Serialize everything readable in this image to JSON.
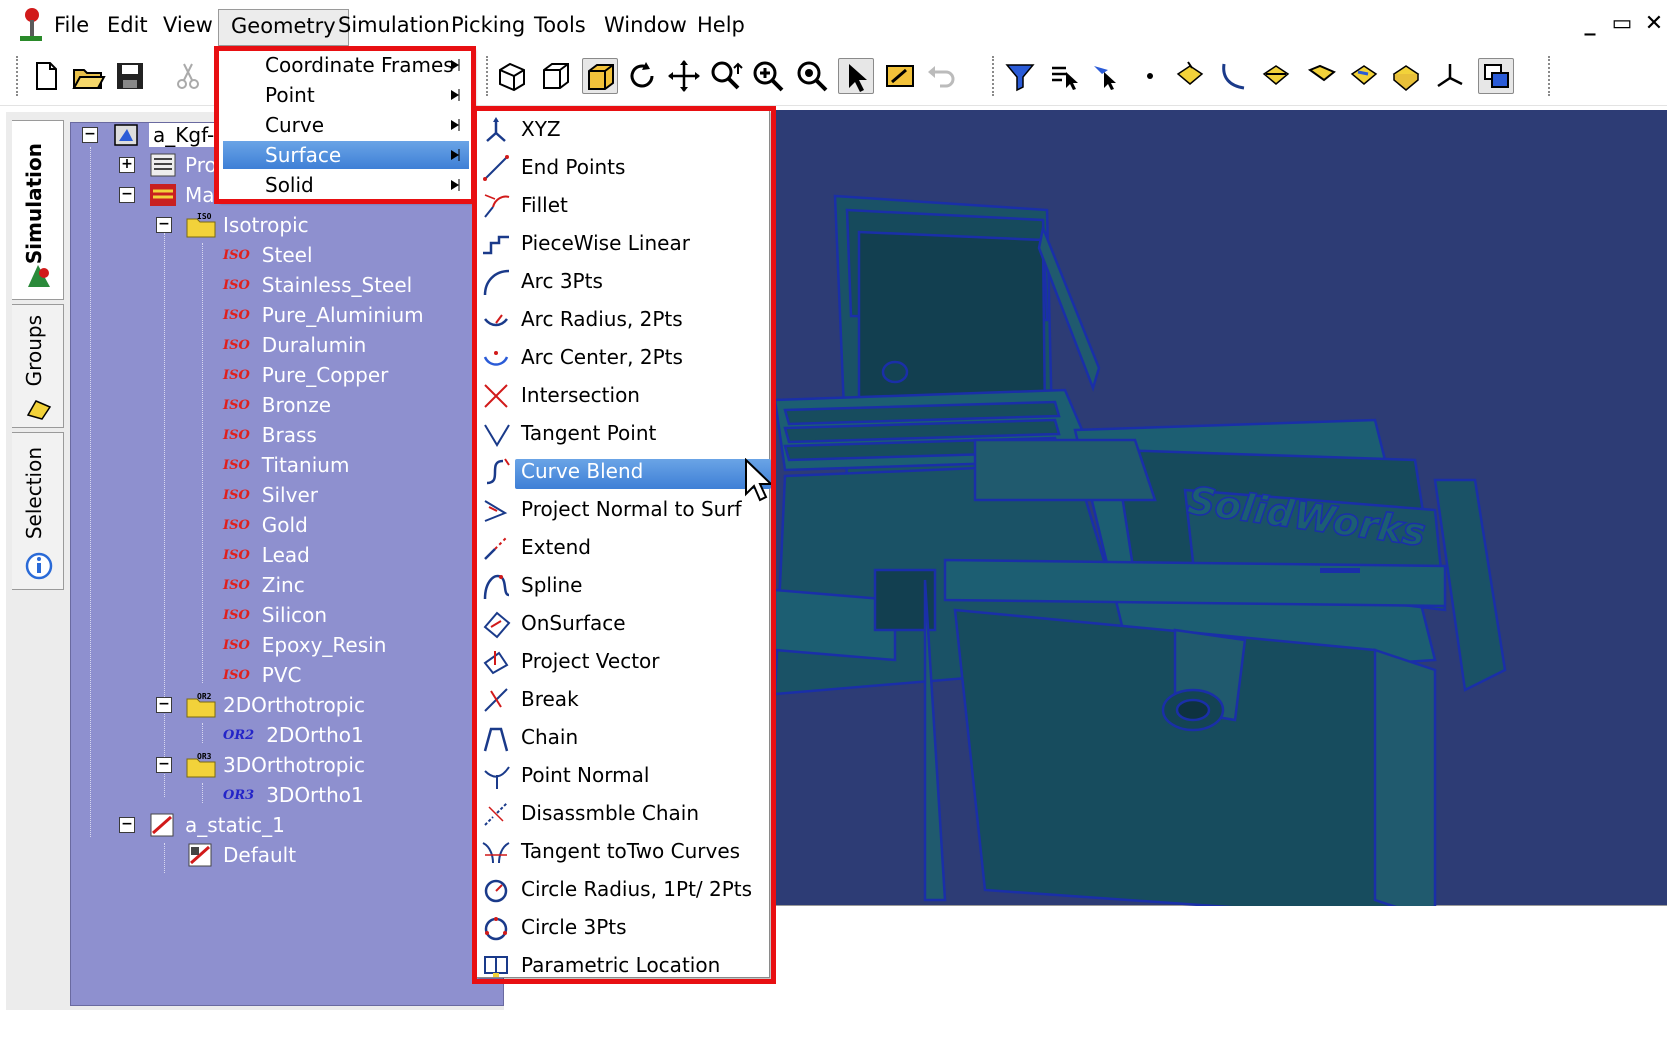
{
  "menubar": {
    "items": [
      "File",
      "Edit",
      "View",
      "Geometry",
      "Simulation",
      "Picking",
      "Tools",
      "Window",
      "Help"
    ],
    "open_menu": "Geometry",
    "window_controls": [
      "_",
      "▭",
      "✕"
    ]
  },
  "geometry_menu": {
    "items": [
      "Coordinate Frames",
      "Point",
      "Curve",
      "Surface",
      "Solid"
    ],
    "highlighted": "Surface"
  },
  "surface_menu": {
    "items": [
      {
        "label": "XYZ",
        "icon": "xyz-icon"
      },
      {
        "label": "End Points",
        "icon": "end-points-icon"
      },
      {
        "label": "Fillet",
        "icon": "fillet-icon"
      },
      {
        "label": "PieceWise Linear",
        "icon": "piecewise-linear-icon"
      },
      {
        "label": "Arc 3Pts",
        "icon": "arc-3pts-icon"
      },
      {
        "label": "Arc Radius, 2Pts",
        "icon": "arc-radius-icon"
      },
      {
        "label": "Arc Center, 2Pts",
        "icon": "arc-center-icon"
      },
      {
        "label": "Intersection",
        "icon": "intersection-icon"
      },
      {
        "label": "Tangent Point",
        "icon": "tangent-point-icon"
      },
      {
        "label": "Curve Blend",
        "icon": "curve-blend-icon"
      },
      {
        "label": "Project Normal to Surf",
        "icon": "project-normal-icon"
      },
      {
        "label": "Extend",
        "icon": "extend-icon"
      },
      {
        "label": "Spline",
        "icon": "spline-icon"
      },
      {
        "label": "OnSurface",
        "icon": "on-surface-icon"
      },
      {
        "label": "Project Vector",
        "icon": "project-vector-icon"
      },
      {
        "label": "Break",
        "icon": "break-icon"
      },
      {
        "label": "Chain",
        "icon": "chain-icon"
      },
      {
        "label": "Point Normal",
        "icon": "point-normal-icon"
      },
      {
        "label": "Disassmble Chain",
        "icon": "disassemble-chain-icon"
      },
      {
        "label": "Tangent toTwo Curves",
        "icon": "tangent-two-curves-icon"
      },
      {
        "label": "Circle Radius, 1Pt/ 2Pts",
        "icon": "circle-radius-icon"
      },
      {
        "label": "Circle 3Pts",
        "icon": "circle-3pts-icon"
      },
      {
        "label": "Parametric Location",
        "icon": "parametric-location-icon"
      }
    ],
    "highlighted": "Curve Blend"
  },
  "side_tabs": [
    "Simulation",
    "Groups",
    "Selection"
  ],
  "tree": {
    "root": "a_Kgf-r",
    "properties_partial": "Pro",
    "materials_partial": "Ma",
    "isotropic": {
      "label": "Isotropic",
      "badge": "ISO",
      "tag": "ISO",
      "items": [
        "Steel",
        "Stainless_Steel",
        "Pure_Aluminium",
        "Duralumin",
        "Pure_Copper",
        "Bronze",
        "Brass",
        "Titanium",
        "Silver",
        "Gold",
        "Lead",
        "Zinc",
        "Silicon",
        "Epoxy_Resin",
        "PVC"
      ]
    },
    "ortho2d": {
      "label": "2DOrthotropic",
      "badge": "OR2",
      "tag": "OR2",
      "items": [
        "2DOrtho1"
      ]
    },
    "ortho3d": {
      "label": "3DOrthotropic",
      "badge": "OR3",
      "tag": "OR3",
      "items": [
        "3DOrtho1"
      ]
    },
    "study": {
      "label": "a_static_1",
      "child": "Default"
    }
  },
  "expander_symbols": {
    "collapse": "−",
    "expand": "+"
  },
  "viewport": {
    "model_text": "SolidWorks"
  },
  "colors": {
    "highlight": "#3e7fd6",
    "annotation_red": "#e80f12",
    "tree_background": "#8e90cf",
    "viewport_background": "#2d3c75",
    "model_color": "#1c5e72"
  }
}
